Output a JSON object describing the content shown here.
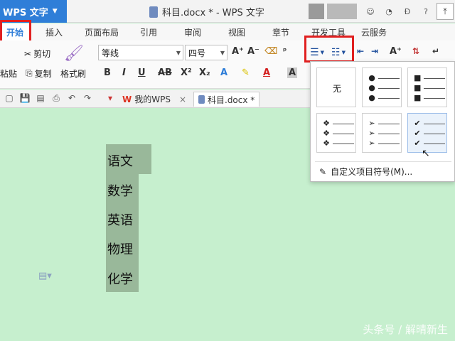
{
  "app": {
    "menu_button": "WPS 文字",
    "window_title": "科目.docx * - WPS 文字"
  },
  "tabs": [
    "开始",
    "插入",
    "页面布局",
    "引用",
    "审阅",
    "视图",
    "章节",
    "开发工具",
    "云服务"
  ],
  "ribbon": {
    "cut": "剪切",
    "paste": "粘贴",
    "copy": "复制",
    "format_painter": "格式刷",
    "font_name": "等线",
    "font_size": "四号"
  },
  "doc_tabs": {
    "home_tab": "我的WPS",
    "file_tab": "科目.docx *"
  },
  "document": {
    "lines": [
      "语文",
      "数学",
      "英语",
      "物理",
      "化学"
    ]
  },
  "bullet_menu": {
    "none_label": "无",
    "custom_label": "自定义项目符号(M)..."
  },
  "watermark": "头条号 / 解晴新生",
  "colors": {
    "accent": "#2f7ed8",
    "highlight_box": "#e02020",
    "doc_background": "#c6efce",
    "selection": "#99b89a"
  }
}
